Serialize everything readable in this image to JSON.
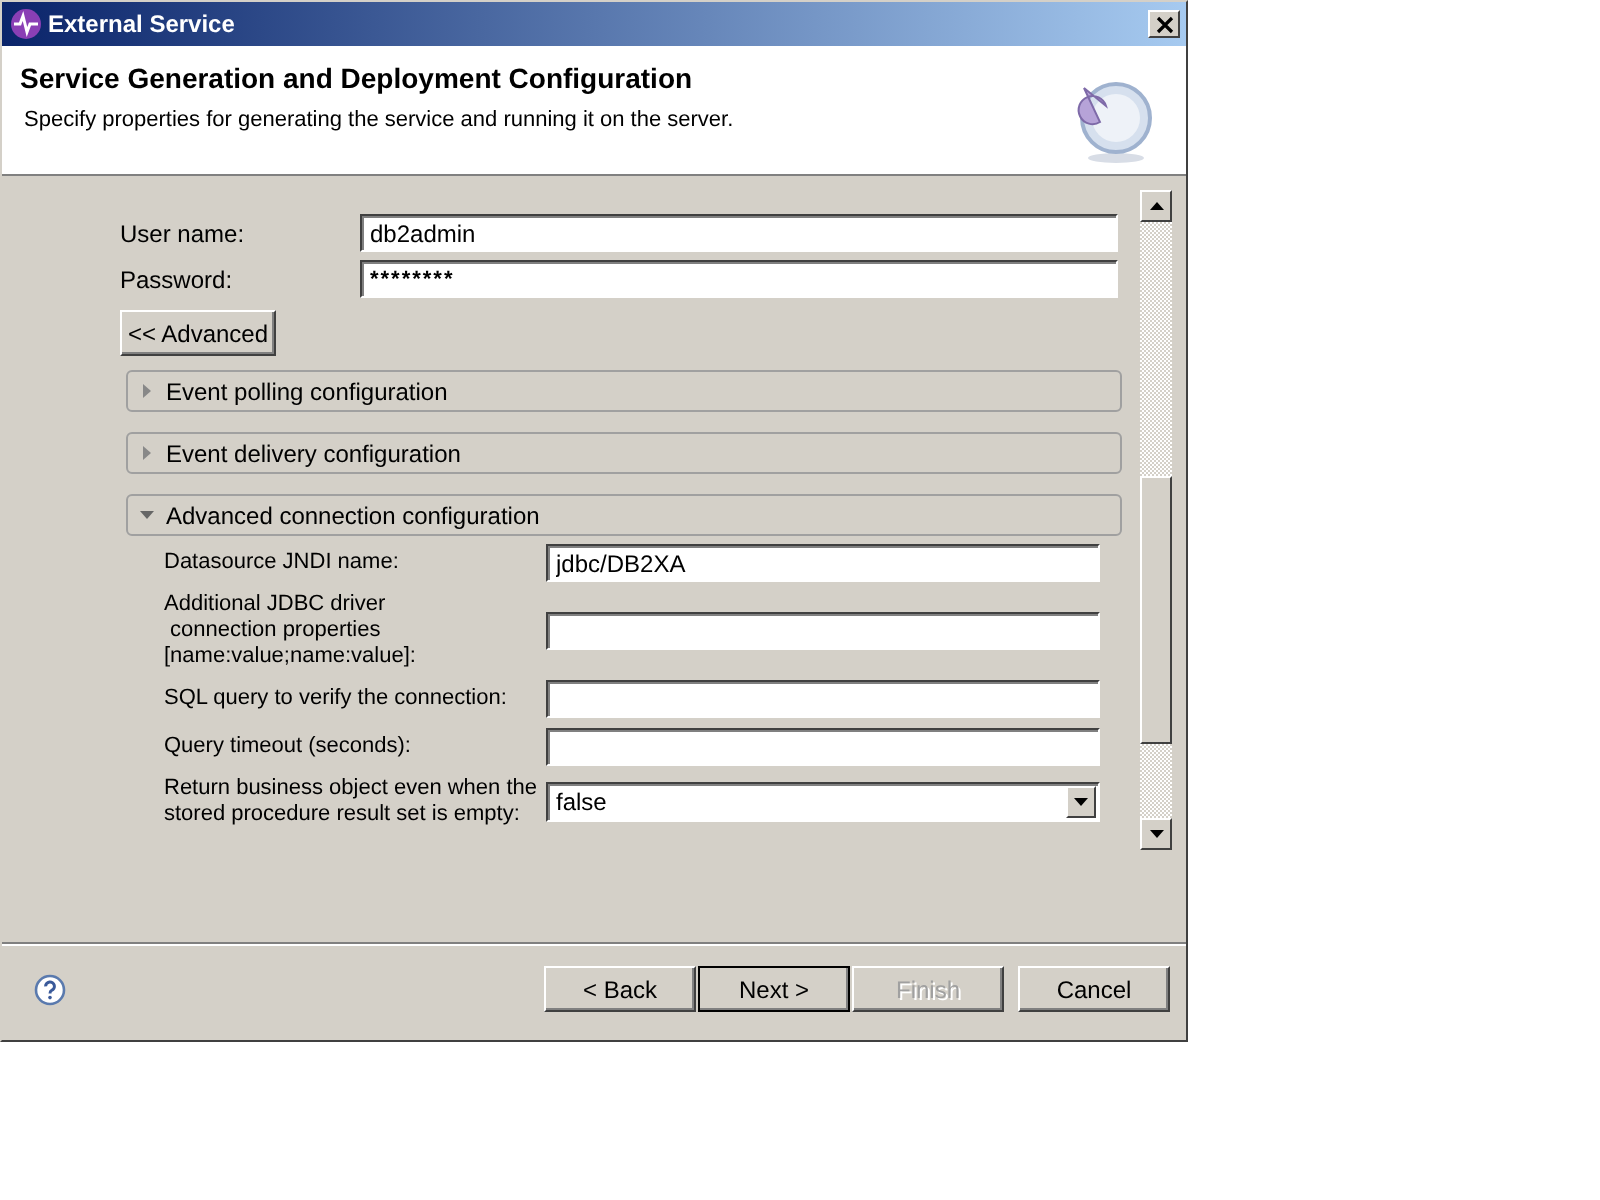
{
  "window": {
    "title": "External Service"
  },
  "header": {
    "title": "Service Generation and Deployment Configuration",
    "description": "Specify properties for generating the service and running it on the server."
  },
  "fields": [
    {
      "label": "User name:",
      "kind": "text",
      "value": "db2admin"
    },
    {
      "label": "Password:",
      "kind": "password",
      "value": "********"
    }
  ],
  "advanced_button": "<< Advanced",
  "sections": [
    {
      "title": "Event polling configuration",
      "expanded": false
    },
    {
      "title": "Event delivery configuration",
      "expanded": false
    },
    {
      "title": "Advanced connection configuration",
      "expanded": true,
      "fields": [
        {
          "label": "Datasource JNDI name:",
          "kind": "text",
          "value": "jdbc/DB2XA"
        },
        {
          "label": "Additional JDBC driver\n connection properties\n[name:value;name:value]:",
          "kind": "text"
        },
        {
          "label": "SQL query to verify the connection:",
          "kind": "text"
        },
        {
          "label": "Query timeout (seconds):",
          "kind": "text"
        },
        {
          "label": "Return business object even when the\nstored procedure result set is empty:",
          "kind": "select",
          "value": "false"
        }
      ]
    }
  ],
  "buttons": [
    {
      "label": "< Back",
      "disabled": false,
      "default": false
    },
    {
      "label": "Next >",
      "disabled": false,
      "default": true
    },
    {
      "label": "Finish",
      "disabled": true,
      "default": false
    },
    {
      "label": "Cancel",
      "disabled": false,
      "default": false
    }
  ]
}
